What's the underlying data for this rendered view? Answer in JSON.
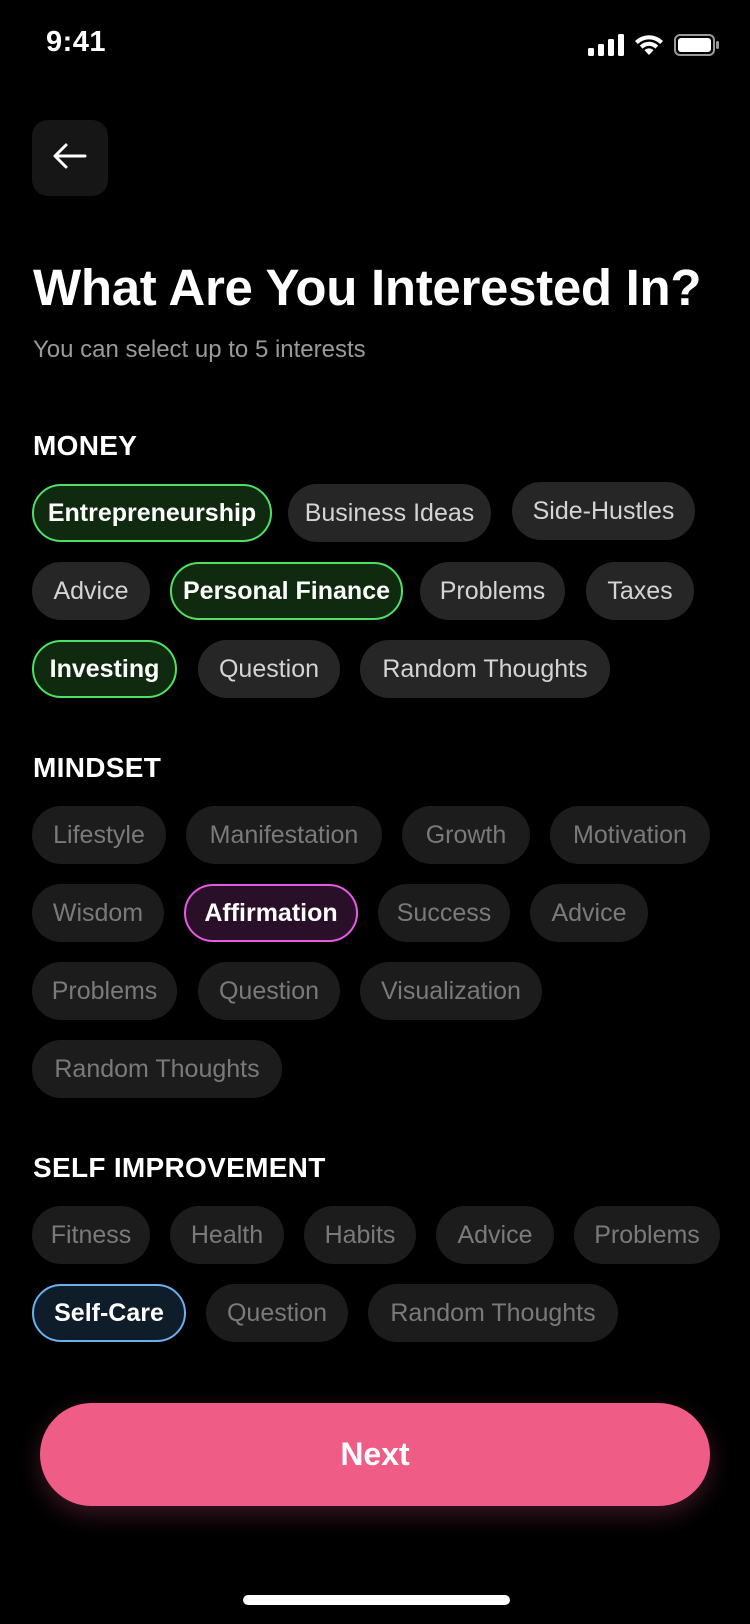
{
  "status": {
    "time": "9:41"
  },
  "header": {
    "title": "What Are You Interested In?",
    "subtitle": "You can select up to 5 interests"
  },
  "sections": {
    "money": {
      "title": "MONEY",
      "chips": [
        {
          "label": "Entrepreneurship",
          "selected": true
        },
        {
          "label": "Business Ideas",
          "selected": false
        },
        {
          "label": "Side-Hustles",
          "selected": false
        },
        {
          "label": "Advice",
          "selected": false
        },
        {
          "label": "Personal Finance",
          "selected": true
        },
        {
          "label": "Problems",
          "selected": false
        },
        {
          "label": "Taxes",
          "selected": false
        },
        {
          "label": "Investing",
          "selected": true
        },
        {
          "label": "Question",
          "selected": false
        },
        {
          "label": "Random Thoughts",
          "selected": false
        }
      ]
    },
    "mindset": {
      "title": "MINDSET",
      "chips": [
        {
          "label": "Lifestyle",
          "selected": false
        },
        {
          "label": "Manifestation",
          "selected": false
        },
        {
          "label": "Growth",
          "selected": false
        },
        {
          "label": "Motivation",
          "selected": false
        },
        {
          "label": "Wisdom",
          "selected": false
        },
        {
          "label": "Affirmation",
          "selected": true
        },
        {
          "label": "Success",
          "selected": false
        },
        {
          "label": "Advice",
          "selected": false
        },
        {
          "label": "Problems",
          "selected": false
        },
        {
          "label": "Question",
          "selected": false
        },
        {
          "label": "Visualization",
          "selected": false
        },
        {
          "label": "Random Thoughts",
          "selected": false
        }
      ]
    },
    "self_improvement": {
      "title": "SELF IMPROVEMENT",
      "chips": [
        {
          "label": "Fitness",
          "selected": false
        },
        {
          "label": "Health",
          "selected": false
        },
        {
          "label": "Habits",
          "selected": false
        },
        {
          "label": "Advice",
          "selected": false
        },
        {
          "label": "Problems",
          "selected": false
        },
        {
          "label": "Self-Care",
          "selected": true
        },
        {
          "label": "Question",
          "selected": false
        },
        {
          "label": "Random Thoughts",
          "selected": false
        }
      ]
    }
  },
  "footer": {
    "next_label": "Next"
  },
  "colors": {
    "money_selected": "#4fe063",
    "mindset_selected": "#e85ae4",
    "self_improvement_selected": "#6ab0ec",
    "primary_button": "#ef5d87"
  },
  "icons": {
    "back": "arrow-left-icon",
    "signal": "cellular-signal-icon",
    "wifi": "wifi-icon",
    "battery": "battery-icon"
  }
}
